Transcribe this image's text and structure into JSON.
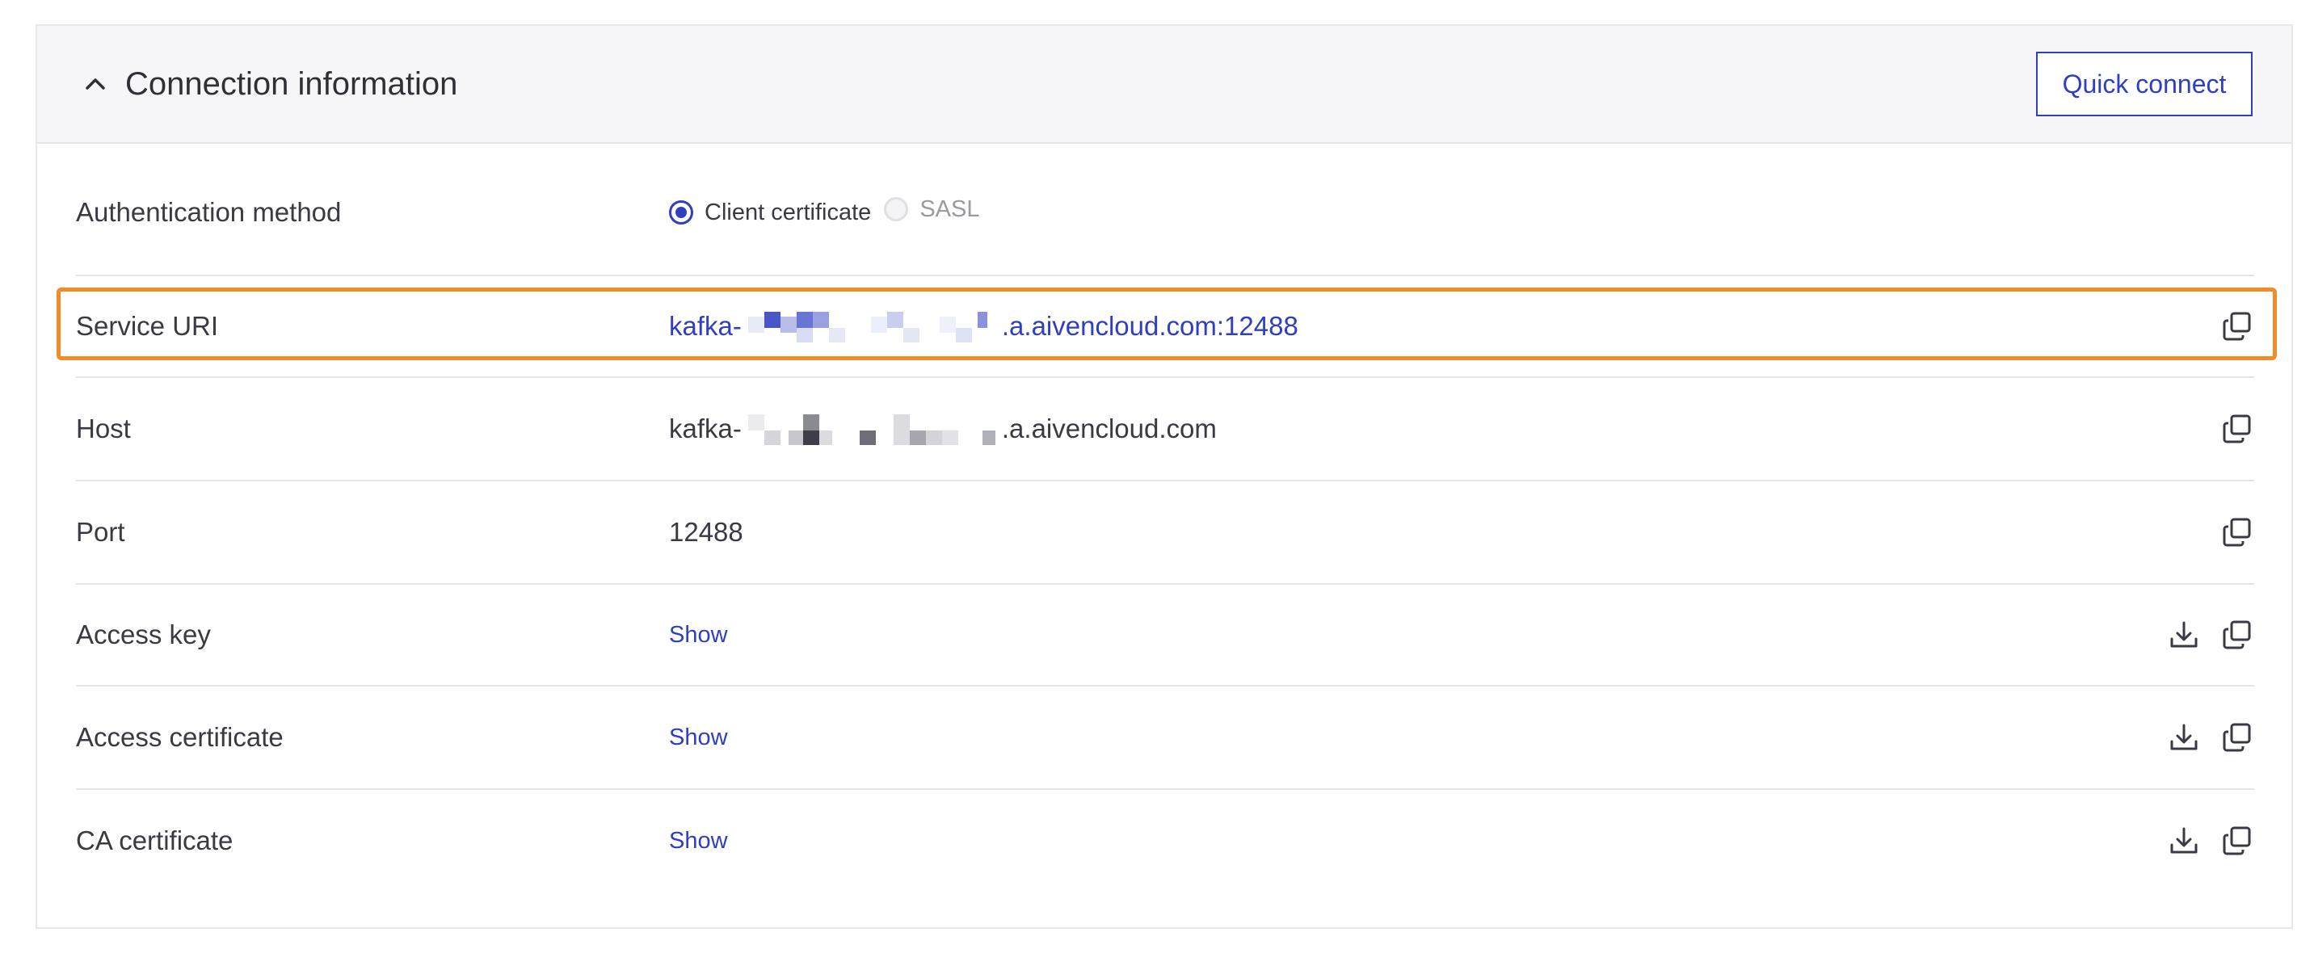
{
  "panel": {
    "title": "Connection information",
    "quick_connect_label": "Quick connect"
  },
  "auth": {
    "label": "Authentication method",
    "options": [
      {
        "label": "Client certificate",
        "selected": true,
        "disabled": false
      },
      {
        "label": "SASL",
        "selected": false,
        "disabled": true
      }
    ]
  },
  "service_uri": {
    "label": "Service URI",
    "value_prefix": "kafka-",
    "value_suffix": ".a.aivencloud.com:12488",
    "copy_icon": "copy-icon"
  },
  "host": {
    "label": "Host",
    "value_prefix": "kafka-",
    "value_suffix": ".a.aivencloud.com",
    "copy_icon": "copy-icon"
  },
  "port": {
    "label": "Port",
    "value": "12488",
    "copy_icon": "copy-icon"
  },
  "access_key": {
    "label": "Access key",
    "show_label": "Show",
    "icons": [
      "download-icon",
      "copy-icon"
    ]
  },
  "access_certificate": {
    "label": "Access certificate",
    "show_label": "Show",
    "icons": [
      "download-icon",
      "copy-icon"
    ]
  },
  "ca_certificate": {
    "label": "CA certificate",
    "show_label": "Show",
    "icons": [
      "download-icon",
      "copy-icon"
    ]
  },
  "colors": {
    "accent": "#2f3fbf",
    "highlight": "#f28c28",
    "text": "#3a3a44",
    "header_bg": "#f6f6f8"
  }
}
